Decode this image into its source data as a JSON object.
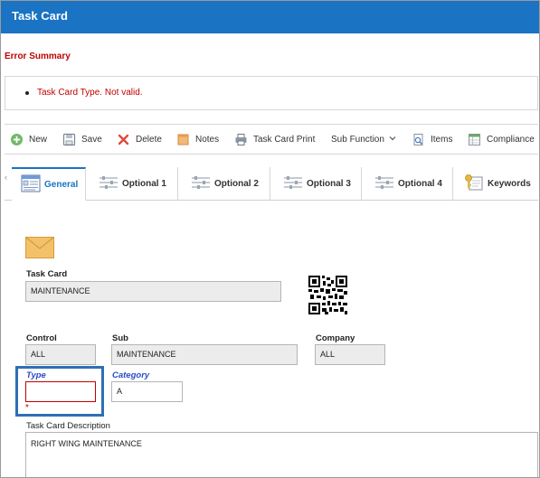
{
  "window": {
    "title": "Task Card"
  },
  "errors": {
    "title": "Error Summary",
    "items": [
      "Task Card Type. Not valid."
    ]
  },
  "toolbar": {
    "items": [
      {
        "label": "New",
        "icon": "plus-circle-icon"
      },
      {
        "label": "Save",
        "icon": "save-icon"
      },
      {
        "label": "Delete",
        "icon": "delete-x-icon"
      },
      {
        "label": "Notes",
        "icon": "notes-icon"
      },
      {
        "label": "Task Card Print",
        "icon": "printer-icon"
      },
      {
        "label": "Sub Function",
        "icon": "chevron-down-icon"
      },
      {
        "label": "Items",
        "icon": "items-icon"
      },
      {
        "label": "Compliance",
        "icon": "compliance-icon"
      }
    ]
  },
  "tabs": [
    {
      "label": "General",
      "icon": "form-icon",
      "active": true
    },
    {
      "label": "Optional 1",
      "icon": "sliders-icon"
    },
    {
      "label": "Optional 2",
      "icon": "sliders-icon"
    },
    {
      "label": "Optional 3",
      "icon": "sliders-icon"
    },
    {
      "label": "Optional 4",
      "icon": "sliders-icon"
    },
    {
      "label": "Keywords",
      "icon": "key-icon"
    }
  ],
  "form": {
    "task_card": {
      "label": "Task Card",
      "value": "MAINTENANCE"
    },
    "control": {
      "label": "Control",
      "value": "ALL"
    },
    "sub": {
      "label": "Sub",
      "value": "MAINTENANCE"
    },
    "company": {
      "label": "Company",
      "value": "ALL"
    },
    "type": {
      "label": "Type",
      "value": "",
      "required_mark": "*"
    },
    "category": {
      "label": "Category",
      "value": "A"
    },
    "description": {
      "label": "Task Card Description",
      "value": "RIGHT WING MAINTENANCE"
    }
  },
  "colors": {
    "header": "#1a73c3",
    "error": "#c00000",
    "highlight": "#2f6fb5",
    "link_label": "#2a4cc8"
  }
}
